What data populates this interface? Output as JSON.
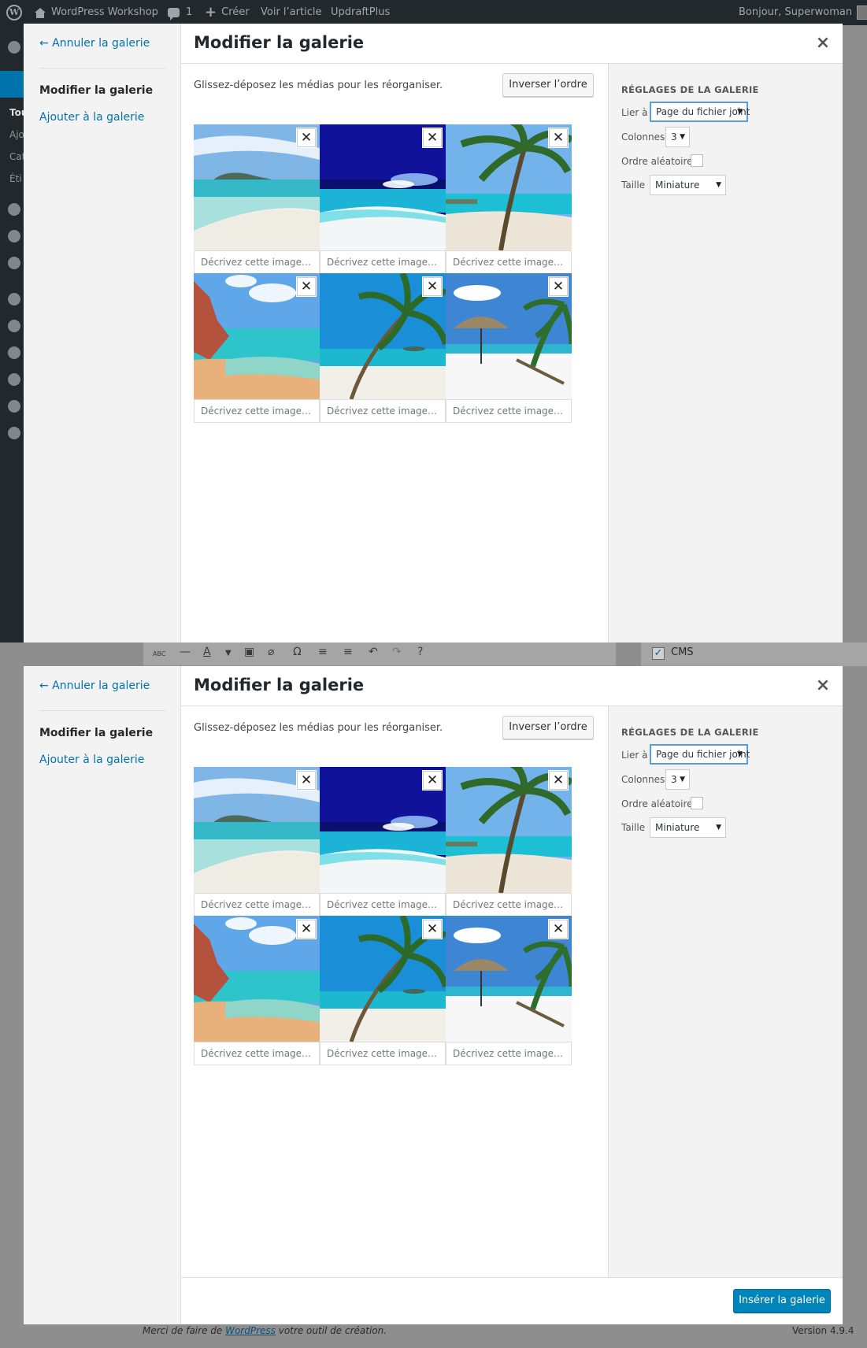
{
  "adminbar": {
    "site_name": "WordPress Workshop",
    "comments_count": "1",
    "new_label": "Créer",
    "view_label": "Voir l’article",
    "plugin_label": "UpdraftPlus",
    "greeting": "Bonjour, Superwoman"
  },
  "admin_sidebar": {
    "texts": [
      "Tou",
      "Ajo",
      "Cat",
      "Éti"
    ]
  },
  "editor_strip": {
    "cms_label": "CMS"
  },
  "footer": {
    "thanks_before": "Merci de faire de ",
    "thanks_link": "WordPress",
    "thanks_after": " votre outil de création.",
    "version": "Version 4.9.4"
  },
  "modal": {
    "cancel_label": "← Annuler la galerie",
    "menu_items": [
      "Modifier la galerie",
      "Ajouter à la galerie"
    ],
    "title": "Modifier la galerie",
    "close_symbol": "×",
    "instructions": "Glissez-déposez les médias pour les réorganiser.",
    "reverse_label": "Inverser l’ordre",
    "caption_placeholder": "Décrivez cette image…",
    "remove_symbol": "✕",
    "settings": {
      "heading": "RÉGLAGES DE LA GALERIE",
      "link_label": "Lier à",
      "link_value": "Page du fichier joint",
      "columns_label": "Colonnes",
      "columns_value": "3",
      "random_label": "Ordre aléatoire",
      "random_checked": false,
      "size_label": "Taille",
      "size_value": "Miniature"
    },
    "insert_label": "Insérer la galerie",
    "images": [
      {
        "description": "beach-shore-icon"
      },
      {
        "description": "lagoon-night-sky-icon"
      },
      {
        "description": "palm-beach-icon"
      },
      {
        "description": "rocky-cove-icon"
      },
      {
        "description": "leaning-palm-icon"
      },
      {
        "description": "umbrella-beach-icon"
      }
    ]
  }
}
